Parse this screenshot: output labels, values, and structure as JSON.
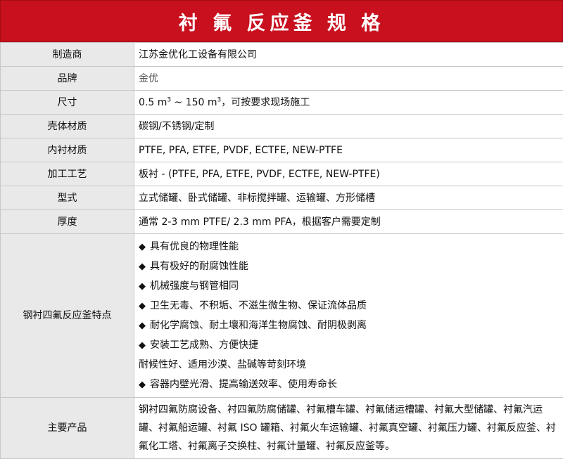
{
  "title": "衬 氟 反应釜   规 格",
  "rows": [
    {
      "label": "制造商",
      "value": "江苏金优化工设备有限公司"
    },
    {
      "label": "品牌",
      "value": "金优"
    },
    {
      "label": "尺寸",
      "v1": "0.5 m",
      "sup1": "3",
      "v2": " ~ 150 m",
      "sup2": "3",
      "v3": "，可按要求现场施工"
    },
    {
      "label": "壳体材质",
      "value": "碳钢/不锈钢/定制"
    },
    {
      "label": "内衬材质",
      "value": "PTFE, PFA, ETFE, PVDF, ECTFE, NEW-PTFE"
    },
    {
      "label": "加工工艺",
      "value": "板衬 - (PTFE, PFA, ETFE, PVDF, ECTFE, NEW-PTFE)"
    },
    {
      "label": "型式",
      "value": "立式储罐、卧式储罐、非标搅拌罐、运输罐、方形储槽"
    },
    {
      "label": "厚度",
      "value": "通常 2-3 mm PTFE/ 2.3 mm PFA，根据客户需要定制"
    }
  ],
  "features": {
    "label": "钢衬四氟反应釜特点",
    "bullet": "◆",
    "items": [
      "具有优良的物理性能",
      "具有极好的耐腐蚀性能",
      "机械强度与钢管相同",
      "卫生无毒、不积垢、不滋生微生物、保证流体品质",
      "耐化学腐蚀、耐土壤和海洋生物腐蚀、耐阴极剥离",
      "安装工艺成熟、方便快捷"
    ],
    "plain_line": "耐候性好、适用沙漠、盐碱等苛刻环境",
    "last_item": "容器内壁光滑、提高输送效率、使用寿命长"
  },
  "products": {
    "label": "主要产品",
    "text": "钢衬四氟防腐设备、衬四氟防腐储罐、衬氟槽车罐、衬氟储运槽罐、衬氟大型储罐、衬氟汽运罐、衬氟船运罐、衬氟 ISO 罐箱、衬氟火车运输罐、衬氟真空罐、衬氟压力罐、衬氟反应釜、衬氟化工塔、衬氟离子交换柱、衬氟计量罐、衬氟反应釜等。"
  }
}
